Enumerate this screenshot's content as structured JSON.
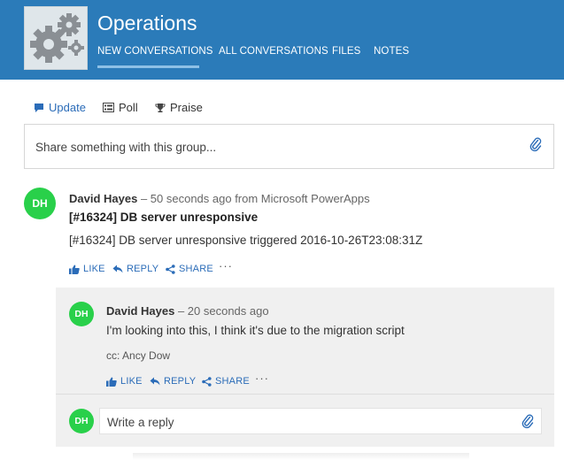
{
  "header": {
    "group_name": "Operations",
    "tabs": [
      {
        "label": "NEW CONVERSATIONS",
        "active": true
      },
      {
        "label": "ALL CONVERSATIONS"
      },
      {
        "label": "FILES"
      },
      {
        "label": "NOTES"
      }
    ]
  },
  "publisher": {
    "tabs": [
      {
        "label": "Update",
        "icon": "message-icon",
        "active": true
      },
      {
        "label": "Poll",
        "icon": "poll-icon"
      },
      {
        "label": "Praise",
        "icon": "trophy-icon"
      }
    ],
    "placeholder": "Share something with this group..."
  },
  "thread": {
    "post": {
      "avatar_initials": "DH",
      "author": "David Hayes",
      "meta": "– 50 seconds ago from Microsoft PowerApps",
      "title": "[#16324] DB server unresponsive",
      "body": "[#16324] DB server unresponsive triggered 2016-10-26T23:08:31Z",
      "actions": {
        "like": "LIKE",
        "reply": "REPLY",
        "share": "SHARE",
        "more": "···"
      }
    },
    "reply": {
      "avatar_initials": "DH",
      "author": "David Hayes",
      "meta": "– 20 seconds ago",
      "body": "I'm looking into this, I think it's due to the migration script",
      "cc_prefix": "cc:",
      "cc_user": "Ancy Dow",
      "actions": {
        "like": "LIKE",
        "reply": "REPLY",
        "share": "SHARE",
        "more": "···"
      }
    },
    "composer": {
      "avatar_initials": "DH",
      "placeholder": "Write a reply"
    }
  },
  "colors": {
    "header_bg": "#2b7bb9",
    "link_blue": "#2b6cb8",
    "avatar_green": "#29d04a",
    "thread_bg": "#f0f0f0"
  }
}
